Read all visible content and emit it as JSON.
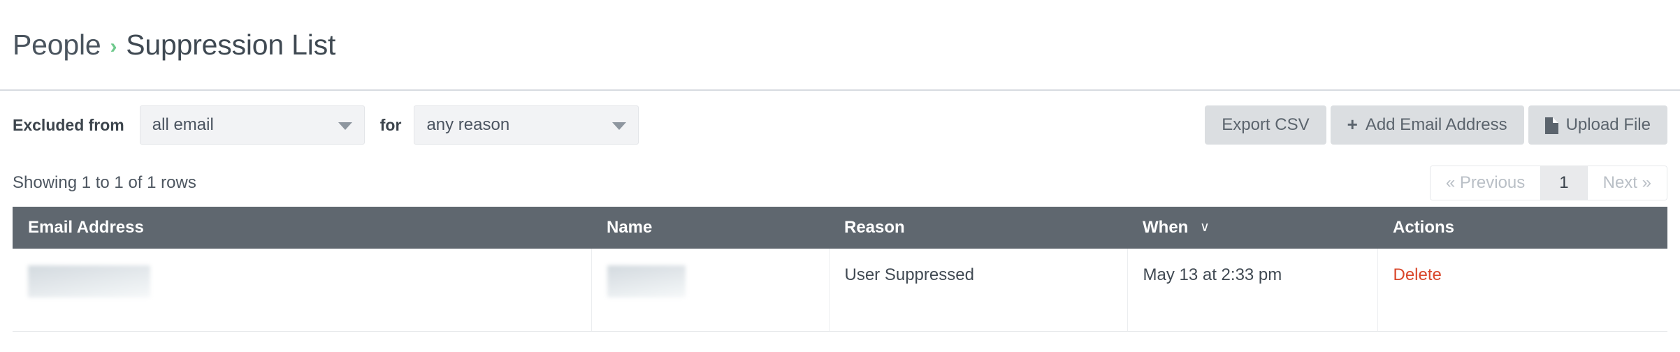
{
  "breadcrumb": {
    "parent": "People",
    "separator": "›",
    "current": "Suppression List"
  },
  "toolbar": {
    "filter_label_from": "Excluded from",
    "filter_label_for": "for",
    "excluded_from": {
      "selected": "all email",
      "icon": "chevron-down-icon"
    },
    "reason": {
      "selected": "any reason",
      "icon": "chevron-down-icon"
    },
    "buttons": [
      {
        "label": "Export CSV",
        "icon": null
      },
      {
        "label": "Add Email Address",
        "icon": "plus-icon",
        "glyph": "➕"
      },
      {
        "label": "Upload File",
        "icon": "file-icon"
      }
    ],
    "export_csv_label": "Export CSV",
    "add_email_label": "Add Email Address",
    "upload_file_label": "Upload File",
    "plus_glyph": "+"
  },
  "info": {
    "rows_summary": "Showing 1 to 1 of 1 rows"
  },
  "pagination": {
    "previous_label": "« Previous",
    "page_label": "1",
    "next_label": "Next »",
    "current_page": 1,
    "previous_disabled": true,
    "next_disabled": true
  },
  "table": {
    "columns": [
      {
        "label": "Email Address",
        "sort": null
      },
      {
        "label": "Name",
        "sort": null
      },
      {
        "label": "Reason",
        "sort": null
      },
      {
        "label": "When",
        "sort": "desc",
        "sort_glyph": "∨"
      },
      {
        "label": "Actions",
        "sort": null
      }
    ],
    "rows": [
      {
        "email": "",
        "email_redacted": true,
        "name": "",
        "name_redacted": true,
        "reason": "User Suppressed",
        "when": "May 13 at 2:33 pm",
        "action_label": "Delete"
      }
    ]
  },
  "colors": {
    "breadcrumb_separator": "#6ec98c",
    "table_header_bg": "#5f676f",
    "delete_link": "#d9472b",
    "button_bg": "#dbdee1",
    "select_bg": "#f2f3f5"
  }
}
